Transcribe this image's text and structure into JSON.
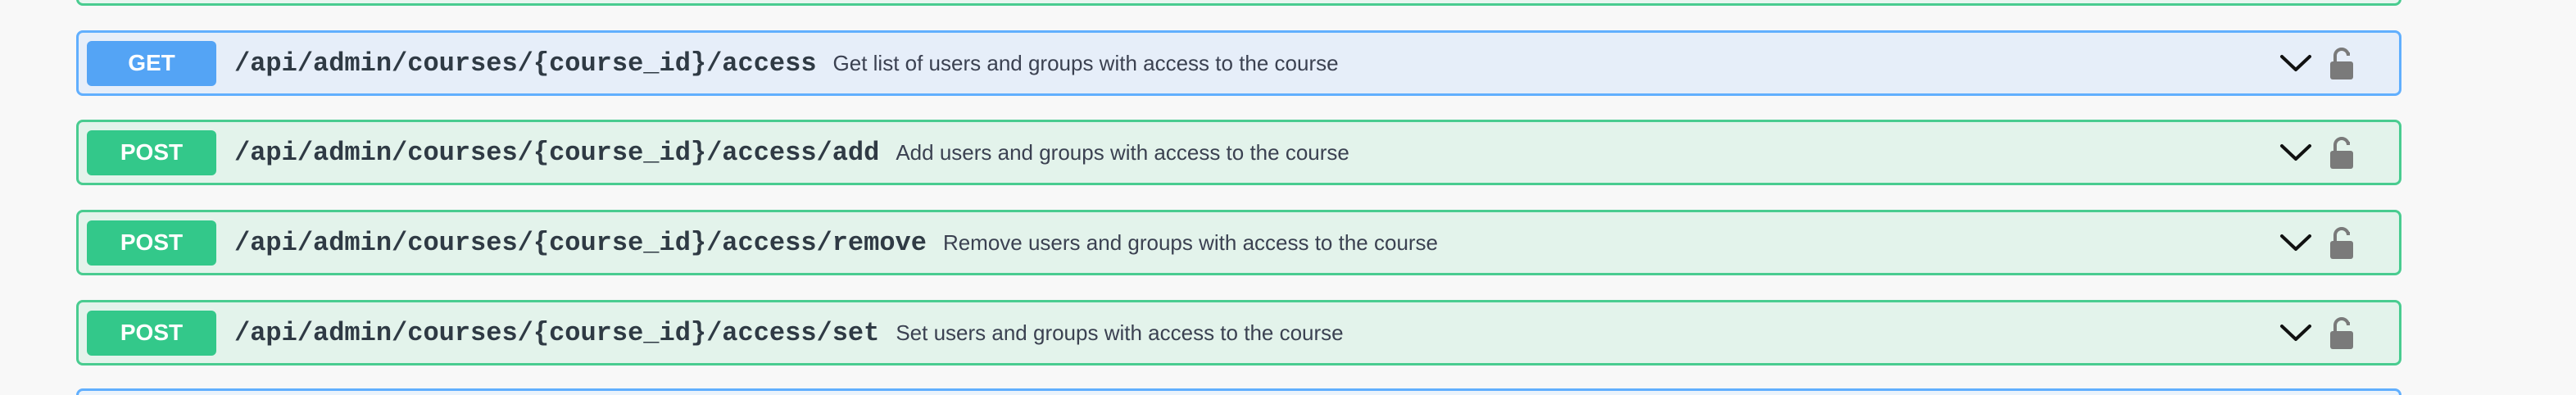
{
  "colors": {
    "post_border": "#49cc90",
    "post_bg": "#e3f3eb",
    "post_method": "#33c88a",
    "get_border": "#61affe",
    "get_bg": "#e6eef9",
    "get_method": "#54a4f5",
    "path_text": "#2f3a44",
    "summary_text": "#3b4151",
    "icon_gray": "#7a7a7a"
  },
  "operations": [
    {
      "method": "GET",
      "path": "/api/admin/courses/{course_id}/access",
      "summary": "Get list of users and groups with access to the course",
      "expand_icon": "chevron-down-icon",
      "auth_icon": "lock-icon"
    },
    {
      "method": "POST",
      "path": "/api/admin/courses/{course_id}/access/add",
      "summary": "Add users and groups with access to the course",
      "expand_icon": "chevron-down-icon",
      "auth_icon": "lock-icon"
    },
    {
      "method": "POST",
      "path": "/api/admin/courses/{course_id}/access/remove",
      "summary": "Remove users and groups with access to the course",
      "expand_icon": "chevron-down-icon",
      "auth_icon": "lock-icon"
    },
    {
      "method": "POST",
      "path": "/api/admin/courses/{course_id}/access/set",
      "summary": "Set users and groups with access to the course",
      "expand_icon": "chevron-down-icon",
      "auth_icon": "lock-icon"
    }
  ]
}
